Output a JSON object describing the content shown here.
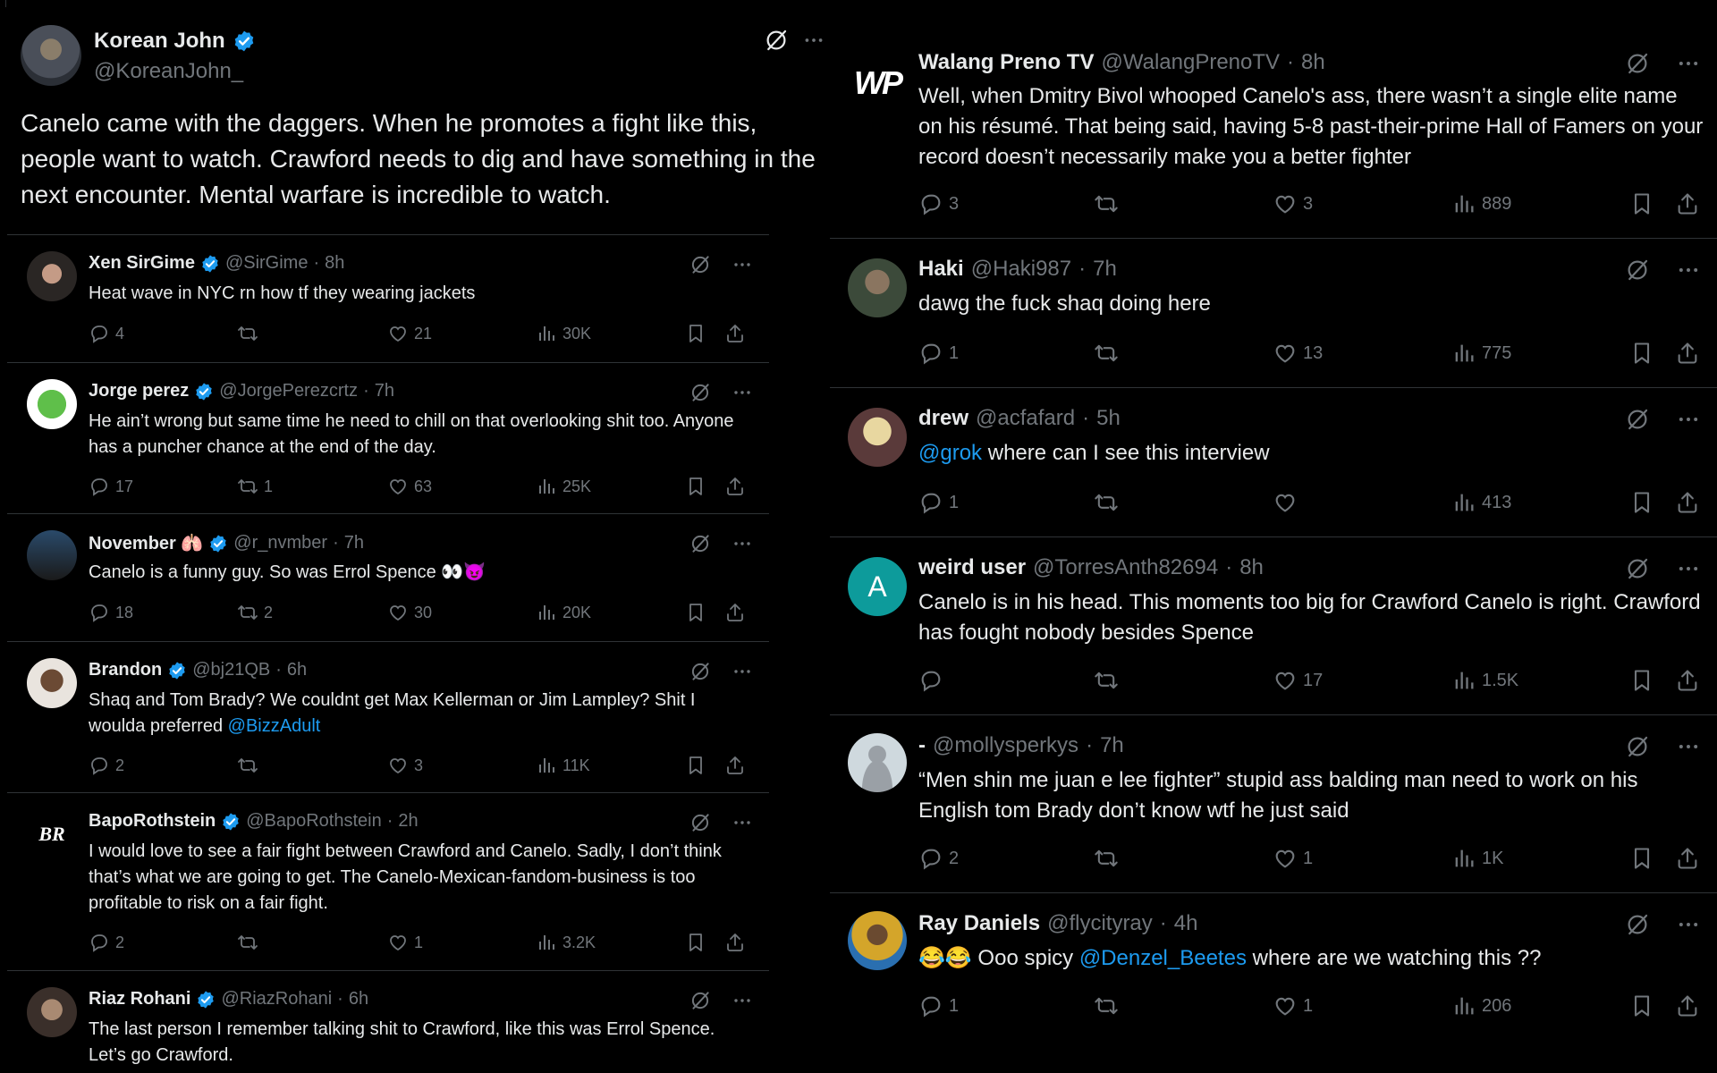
{
  "colors": {
    "background": "#000000",
    "text": "#e7e9ea",
    "muted": "#71767b",
    "link": "#1d9bf0",
    "divider": "#2f3336",
    "verified": "#1d9bf0"
  },
  "main_post": {
    "name": "Korean John",
    "handle": "@KoreanJohn_",
    "verified": true,
    "text_lines": [
      "Canelo came with the daggers. When he promotes a fight like this,",
      "people want to watch. Crawford needs to dig and have something in the",
      "next encounter. Mental warfare is incredible to watch."
    ]
  },
  "left_replies": [
    {
      "name": "Xen SirGime",
      "verified": true,
      "handle": "@SirGime",
      "time": "8h",
      "text": "Heat wave in NYC rn how tf they wearing jackets",
      "replies": "4",
      "reposts": "",
      "likes": "21",
      "views": "30K"
    },
    {
      "name": "Jorge perez",
      "verified": true,
      "handle": "@JorgePerezcrtz",
      "time": "7h",
      "text": "He ain’t wrong but same time he need to chill on that overlooking shit too. Anyone has a puncher chance at the end of the day.",
      "replies": "17",
      "reposts": "1",
      "likes": "63",
      "views": "25K"
    },
    {
      "name": "November 🫁",
      "verified": true,
      "handle": "@r_nvmber",
      "time": "7h",
      "text": "Canelo is a funny guy.  So was Errol Spence  👀😈",
      "replies": "18",
      "reposts": "2",
      "likes": "30",
      "views": "20K"
    },
    {
      "name": "Brandon",
      "verified": true,
      "handle": "@bj21QB",
      "time": "6h",
      "text_before_link": "Shaq and Tom Brady? We couldnt get Max Kellerman or Jim Lampley? Shit I woulda preferred ",
      "link": "@BizzAdult",
      "text_after_link": "",
      "replies": "2",
      "reposts": "",
      "likes": "3",
      "views": "11K"
    },
    {
      "name": "BapoRothstein",
      "verified": true,
      "handle": "@BapoRothstein",
      "time": "2h",
      "text": "I would love to see a fair fight between Crawford and Canelo. Sadly, I don’t think that’s what we are going to get. The Canelo-Mexican-fandom-business is too profitable to risk on a fair fight.",
      "replies": "2",
      "reposts": "",
      "likes": "1",
      "views": "3.2K",
      "avatar_text": "BR"
    },
    {
      "name": "Riaz Rohani",
      "verified": true,
      "handle": "@RiazRohani",
      "time": "6h",
      "text": "The last person I remember talking shit to Crawford, like this was Errol Spence. Let’s go Crawford."
    }
  ],
  "right_replies": [
    {
      "name": "Walang Preno TV",
      "verified": false,
      "handle": "@WalangPrenoTV",
      "time": "8h",
      "text": "Well, when Dmitry Bivol whooped Canelo's ass, there wasn’t a single elite name on his résumé. That being said, having 5-8 past-their-prime Hall of Famers on your record doesn’t necessarily make you a better fighter",
      "replies": "3",
      "reposts": "",
      "likes": "3",
      "views": "889",
      "avatar_text": "WP"
    },
    {
      "name": "Haki",
      "verified": false,
      "handle": "@Haki987",
      "time": "7h",
      "text": "dawg the fuck shaq doing here",
      "replies": "1",
      "reposts": "",
      "likes": "13",
      "views": "775"
    },
    {
      "name": "drew",
      "verified": false,
      "handle": "@acfafard",
      "time": "5h",
      "link": "@grok",
      "text_after_link": " where can I see this interview",
      "replies": "1",
      "reposts": "",
      "likes": "",
      "views": "413"
    },
    {
      "name": "weird user",
      "verified": false,
      "handle": "@TorresAnth82694",
      "time": "8h",
      "text": "Canelo is in his head. This moments too big for Crawford Canelo is right. Crawford has fought nobody besides Spence",
      "replies": "",
      "reposts": "",
      "likes": "17",
      "views": "1.5K",
      "avatar_text": "A"
    },
    {
      "name": "-",
      "verified": false,
      "handle": "@mollysperkys",
      "time": "7h",
      "text": "“Men shin me juan e lee fighter” stupid ass balding man need to work on his English tom Brady don’t know wtf he just said",
      "replies": "2",
      "reposts": "",
      "likes": "1",
      "views": "1K"
    },
    {
      "name": "Ray Daniels",
      "verified": false,
      "handle": "@flycityray",
      "time": "4h",
      "text_before_link": "😂😂 Ooo spicy ",
      "link": "@Denzel_Beetes",
      "text_after_link": " where are we watching this ??",
      "replies": "1",
      "reposts": "",
      "likes": "1",
      "views": "206"
    }
  ],
  "icons": [
    "grok-icon",
    "more-icon",
    "reply-icon",
    "repost-icon",
    "like-icon",
    "views-icon",
    "bookmark-icon",
    "share-icon",
    "verified-icon"
  ]
}
